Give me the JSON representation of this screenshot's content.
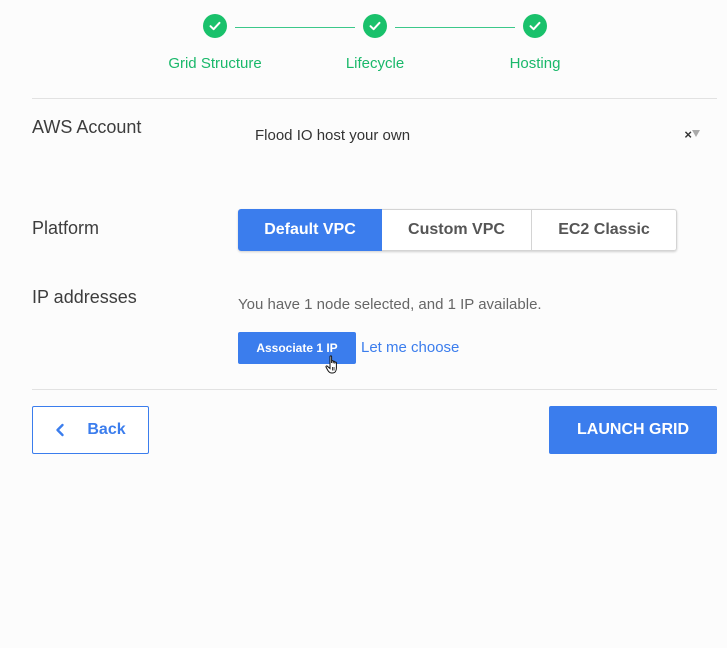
{
  "stepper": {
    "steps": [
      {
        "label": "Grid Structure",
        "status": "complete"
      },
      {
        "label": "Lifecycle",
        "status": "complete"
      },
      {
        "label": "Hosting",
        "status": "complete"
      }
    ],
    "color": "#19c16b"
  },
  "aws_account": {
    "label": "AWS Account",
    "selected_value": "Flood IO host your own",
    "clear_glyph": "×"
  },
  "platform": {
    "label": "Platform",
    "options": [
      "Default VPC",
      "Custom VPC",
      "EC2 Classic"
    ],
    "selected": "Default VPC"
  },
  "ip_addresses": {
    "label": "IP addresses",
    "info_text": "You have 1 node selected, and 1 IP available.",
    "associate_button": "Associate 1 IP",
    "choose_link": "Let me choose"
  },
  "footer": {
    "back_label": "Back",
    "launch_label": "LAUNCH GRID"
  },
  "colors": {
    "accent": "#3b7ded",
    "success": "#19c16b"
  }
}
